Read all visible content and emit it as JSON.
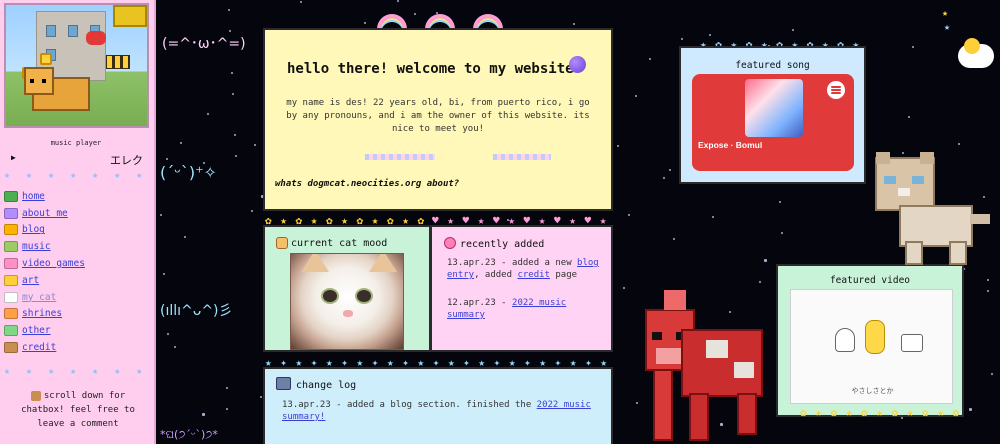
{
  "sidebar": {
    "player_label": "music player",
    "play_symbol": "▶",
    "track_short": "エレク",
    "nav": [
      {
        "label": "home",
        "icon": "leaf-icon"
      },
      {
        "label": "about me",
        "icon": "flower-icon"
      },
      {
        "label": "blog",
        "icon": "sunflower-icon"
      },
      {
        "label": "music",
        "icon": "record-player-icon"
      },
      {
        "label": "video games",
        "icon": "controller-icon"
      },
      {
        "label": "art",
        "icon": "palette-icon"
      },
      {
        "label": "my cat",
        "icon": "cat-icon"
      },
      {
        "label": "shrines",
        "icon": "shrine-icon"
      },
      {
        "label": "other",
        "icon": "present-icon"
      },
      {
        "label": "credit",
        "icon": "bear-icon"
      }
    ],
    "chat_note": "scroll down for chatbox! feel free to leave a comment"
  },
  "kaomoji": {
    "k1": "(=^･ω･^=)",
    "k2": "(ˊᵕˋ)⁺✧",
    "k3": "(ıllı^ᴗ^)彡",
    "k4": "*ଘ(੭ˊᵕˋ)੭*"
  },
  "welcome": {
    "title": "hello there! welcome to my website",
    "body": "my name is des! 22 years old, bi, from puerto rico, i go by any pronouns, and i am the owner of this website. its nice to meet you!",
    "question": "whats dogmcat.neocities.org about?"
  },
  "mood": {
    "title": "current cat mood"
  },
  "recent": {
    "title": "recently added",
    "e1_date": "13.apr.23 - added a new ",
    "e1_link1": "blog entry",
    "e1_mid": ", added ",
    "e1_link2": "credit",
    "e1_end": " page",
    "e2_date": "12.apr.23 - ",
    "e2_link": "2022 music summary"
  },
  "changelog": {
    "title": "change log",
    "text": "13.apr.23 - added a blog section. finished the ",
    "link": "2022 music summary!"
  },
  "featured_song": {
    "title": "featured song",
    "track": "Expose · Bomul"
  },
  "featured_video": {
    "title": "featured video",
    "caption": "やさしさとか"
  },
  "colors": {
    "sidebar_bg": "#ffcdee",
    "welcome_bg": "#fff8b8",
    "mood_bg": "#c9f3d9",
    "recent_bg": "#ffd3f4",
    "changelog_bg": "#cfeefc",
    "spotify_red": "#e03a3a",
    "link": "#3b3fd8"
  }
}
